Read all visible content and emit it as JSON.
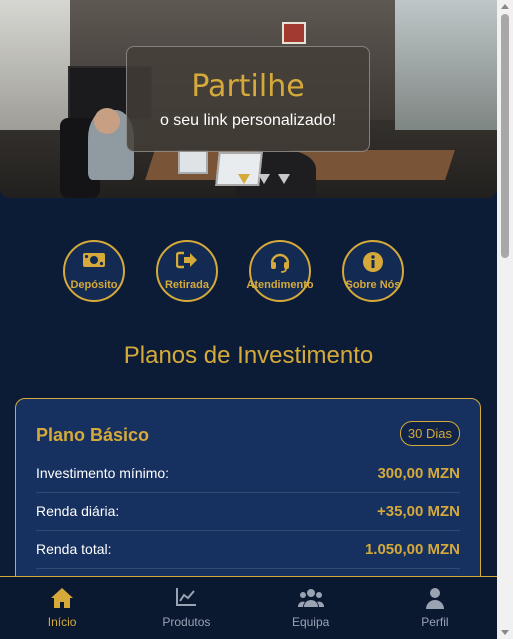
{
  "banner": {
    "title": "Partilhe",
    "subtitle": "o seu link personalizado!",
    "slides_total": 3,
    "active_slide": 1
  },
  "actions": [
    {
      "label": "Depósito",
      "icon": "cash-icon"
    },
    {
      "label": "Retirada",
      "icon": "sign-out-icon"
    },
    {
      "label": "Atendimento",
      "icon": "headset-icon"
    },
    {
      "label": "Sobre Nós",
      "icon": "info-icon"
    }
  ],
  "section": {
    "title": "Planos de Investimento"
  },
  "plan": {
    "name": "Plano Básico",
    "duration": "30 Dias",
    "rows": [
      {
        "label": "Investimento mínimo:",
        "value": "300,00 MZN"
      },
      {
        "label": "Renda diária:",
        "value": "+35,00 MZN"
      },
      {
        "label": "Renda total:",
        "value": "1.050,00 MZN"
      }
    ]
  },
  "nav": {
    "items": [
      {
        "label": "Início",
        "icon": "home-icon",
        "active": true
      },
      {
        "label": "Produtos",
        "icon": "chart-line-icon",
        "active": false
      },
      {
        "label": "Equipa",
        "icon": "users-icon",
        "active": false
      },
      {
        "label": "Perfil",
        "icon": "user-icon",
        "active": false
      }
    ]
  },
  "colors": {
    "accent": "#d5aa3a",
    "background": "#0d1c36",
    "card": "#16305f",
    "inactive": "#9aa3b2"
  }
}
